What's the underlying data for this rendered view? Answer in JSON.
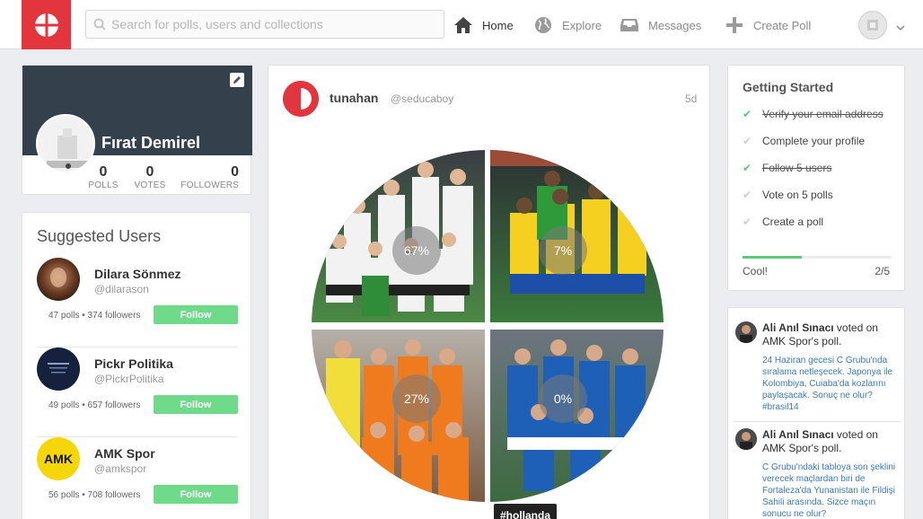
{
  "search": {
    "placeholder": "Search for polls, users and collections"
  },
  "nav": [
    {
      "label": "Home",
      "icon": "home-icon",
      "active": true
    },
    {
      "label": "Explore",
      "icon": "globe-icon",
      "active": false
    },
    {
      "label": "Messages",
      "icon": "inbox-icon",
      "active": false
    },
    {
      "label": "Create Poll",
      "icon": "plus-icon",
      "active": false
    }
  ],
  "colors": {
    "brand": "#e2353d",
    "follow": "#6fdb8a",
    "banner": "#34404b",
    "check": "#5cc97a"
  },
  "profile": {
    "name": "Fırat Demirel",
    "stats": [
      {
        "num": "0",
        "label": "POLLS"
      },
      {
        "num": "0",
        "label": "VOTES"
      },
      {
        "num": "0",
        "label": "FOLLOWERS"
      }
    ]
  },
  "suggested": {
    "title": "Suggested Users",
    "follow_label": "Follow",
    "users": [
      {
        "name": "Dilara Sönmez",
        "handle": "@dilarason",
        "meta": "47 polls • 374 followers"
      },
      {
        "name": "Pickr Politika",
        "handle": "@PickrPolitika",
        "meta": "49 polls • 657 followers"
      },
      {
        "name": "AMK Spor",
        "handle": "@amkspor",
        "meta": "56 polls • 708 followers",
        "logo_text": "AMK"
      }
    ]
  },
  "poll": {
    "user": "tunahan",
    "handle": "@seducaboy",
    "time": "5d",
    "options": [
      {
        "pct": "67%",
        "value": 67,
        "team_color": "#f2f2f2"
      },
      {
        "pct": "7%",
        "value": 7,
        "team_color": "#f5d020"
      },
      {
        "pct": "27%",
        "value": 27,
        "team_color": "#f07a1e"
      },
      {
        "pct": "0%",
        "value": 0,
        "team_color": "#1e5fb8"
      }
    ],
    "tag": "#hollanda"
  },
  "getting_started": {
    "title": "Getting Started",
    "items": [
      {
        "label": "Verify your email address",
        "done": true
      },
      {
        "label": "Complete your profile",
        "done": false
      },
      {
        "label": "Follow 5 users",
        "done": true
      },
      {
        "label": "Vote on 5 polls",
        "done": false
      },
      {
        "label": "Create a poll",
        "done": false
      }
    ],
    "progress": 0.4,
    "footer_left": "Cool!",
    "footer_right": "2/5"
  },
  "activity": [
    {
      "user": "Ali Anıl Sınacı",
      "action": "voted on AMK Spor's poll.",
      "text": "24 Haziran gecesi C Grubu'nda sıralama netleşecek. Japonya ile Kolombiya, Cuiaba'da kozlarını paylaşacak. Sonuç ne olur? #brasil14"
    },
    {
      "user": "Ali Anıl Sınacı",
      "action": "voted on AMK Spor's poll.",
      "text": "C Grubu'ndaki tabloya son şeklini verecek maçlardan biri de Fortaleza'da Yunanistan ile Fildişi Sahili arasında. Sizce maçın sonucu ne olur?"
    }
  ]
}
